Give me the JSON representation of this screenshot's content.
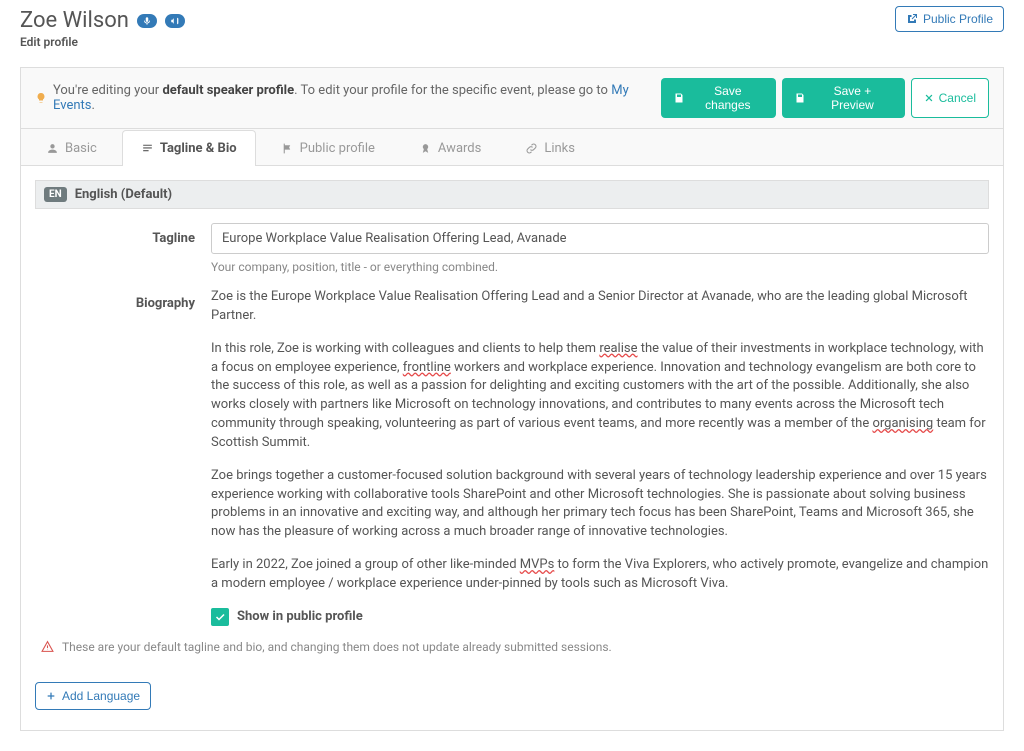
{
  "header": {
    "name": "Zoe Wilson",
    "subtitle": "Edit profile",
    "publicProfile": "Public Profile"
  },
  "tipBar": {
    "prefix": "You're editing your",
    "bold": "default speaker profile",
    "middle": ". To edit your profile for the specific event, please go to",
    "link": "My Events",
    "suffix": "."
  },
  "buttons": {
    "save": "Save changes",
    "savePreview": "Save + Preview",
    "cancel": "Cancel",
    "addLanguage": "Add Language"
  },
  "tabs": {
    "basic": "Basic",
    "taglineBio": "Tagline & Bio",
    "publicProfile": "Public profile",
    "awards": "Awards",
    "links": "Links"
  },
  "language": {
    "code": "EN",
    "label": "English (Default)"
  },
  "labels": {
    "tagline": "Tagline",
    "biography": "Biography"
  },
  "tagline": {
    "value": "Europe Workplace Value Realisation Offering Lead, Avanade",
    "help": "Your company, position, title - or everything combined."
  },
  "bio": {
    "p1a": "Zoe is the Europe Workplace Value Realisation Offering Lead and a Senior Director at Avanade, who are the leading global Microsoft Partner.",
    "p2a": "In this role, Zoe is working with colleagues and clients to help them ",
    "p2_realise": "realise",
    "p2b": " the value of their investments in workplace technology, with a focus on employee experience, ",
    "p2_frontline": "frontline",
    "p2c": " workers and workplace experience. Innovation and technology evangelism are both core to the success of this role, as well as a passion for delighting and exciting customers with the art of the possible. Additionally, she also works closely with partners like Microsoft on technology innovations, and contributes to many events across the Microsoft tech community through speaking, volunteering as part of various event teams, and more recently was a member of the ",
    "p2_organising": "organising",
    "p2d": " team for Scottish Summit.",
    "p3": "Zoe brings together a customer-focused solution background with several years of technology leadership experience and over 15 years experience working with collaborative tools SharePoint and other Microsoft technologies. She is passionate about solving business problems in an innovative and exciting way, and although her primary tech focus has been SharePoint, Teams and Microsoft 365, she now has the pleasure of working across a much broader range of innovative technologies.",
    "p4a": "Early in 2022, Zoe joined a group of other like-minded ",
    "p4_mvps": "MVPs",
    "p4b": " to form the Viva Explorers, who actively promote, evangelize and champion a modern employee / workplace experience under-pinned by tools such as Microsoft Viva."
  },
  "checkbox": {
    "label": "Show in public profile"
  },
  "warning": "These are your default tagline and bio, and changing them does not update already submitted sessions."
}
